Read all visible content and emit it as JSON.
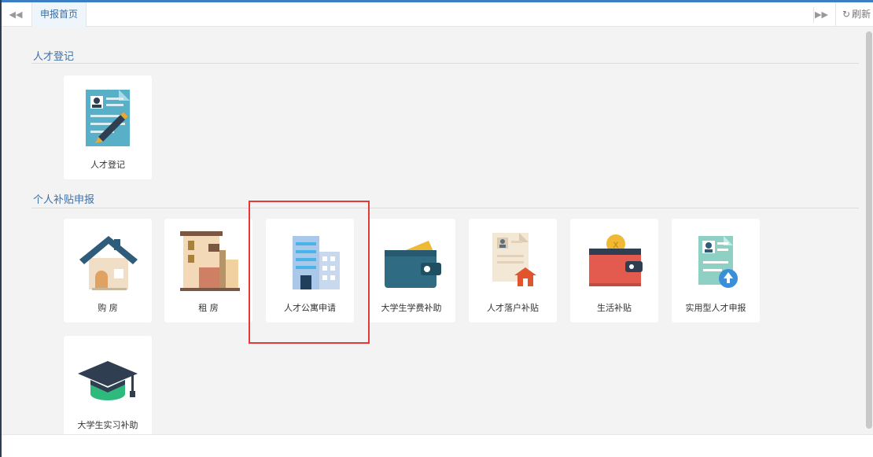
{
  "tabs": {
    "active_label": "申报首页",
    "refresh_label": "刷新"
  },
  "sections": {
    "talent_registration": {
      "title": "人才登记",
      "items": [
        {
          "label": "人才登记",
          "icon": "resume-pen-icon"
        }
      ]
    },
    "personal_subsidy": {
      "title": "个人补贴申报",
      "items": [
        {
          "label": "购 房",
          "icon": "house-icon"
        },
        {
          "label": "租 房",
          "icon": "rent-building-icon"
        },
        {
          "label": "人才公寓申请",
          "icon": "apartment-building-icon"
        },
        {
          "label": "大学生学费补助",
          "icon": "wallet-icon"
        },
        {
          "label": "人才落户补贴",
          "icon": "settlement-document-icon"
        },
        {
          "label": "生活补贴",
          "icon": "living-wallet-icon"
        },
        {
          "label": "实用型人才申报",
          "icon": "resume-upload-icon"
        },
        {
          "label": "大学生实习补助",
          "icon": "graduation-cap-icon"
        }
      ]
    }
  },
  "colors": {
    "accent": "#3b7ec5",
    "section_title": "#3d6fa8",
    "highlight_border": "#e53935"
  }
}
